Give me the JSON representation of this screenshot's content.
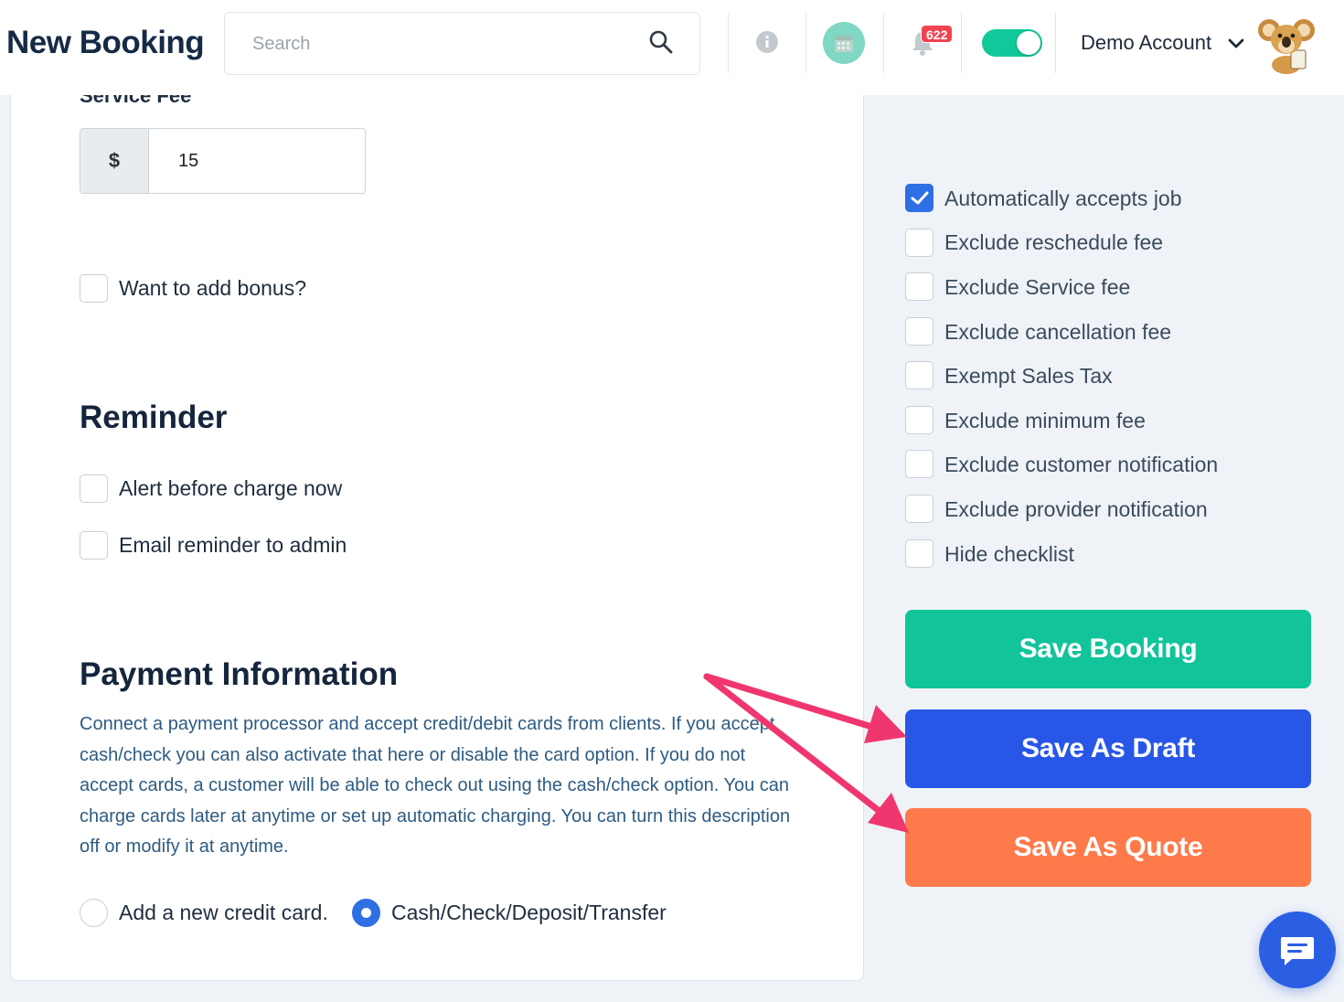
{
  "header": {
    "title": "New Booking",
    "search_placeholder": "Search",
    "notification_count": "622",
    "account_name": "Demo Account",
    "toggle_on": true
  },
  "service_fee": {
    "label": "Service Fee",
    "currency": "$",
    "value": "15"
  },
  "bonus": {
    "label": "Want to add bonus?",
    "checked": false
  },
  "reminder": {
    "title": "Reminder",
    "options": [
      {
        "label": "Alert before charge now",
        "checked": false
      },
      {
        "label": "Email reminder to admin",
        "checked": false
      }
    ]
  },
  "payment": {
    "title": "Payment Information",
    "description": "Connect a payment processor and accept credit/debit cards from clients. If you accept cash/check you can also activate that here or disable the card option. If you do not accept cards, a customer will be able to check out using the cash/check option. You can charge cards later at anytime or set up automatic charging. You can turn this description off or modify it at anytime.",
    "methods": [
      {
        "label": "Add a new credit card.",
        "selected": false
      },
      {
        "label": "Cash/Check/Deposit/Transfer",
        "selected": true
      }
    ]
  },
  "options": [
    {
      "label": "Automatically accepts job",
      "checked": true
    },
    {
      "label": "Exclude reschedule fee",
      "checked": false
    },
    {
      "label": "Exclude Service fee",
      "checked": false
    },
    {
      "label": "Exclude cancellation fee",
      "checked": false
    },
    {
      "label": "Exempt Sales Tax",
      "checked": false
    },
    {
      "label": "Exclude minimum fee",
      "checked": false
    },
    {
      "label": "Exclude customer notification",
      "checked": false
    },
    {
      "label": "Exclude provider notification",
      "checked": false
    },
    {
      "label": "Hide checklist",
      "checked": false
    }
  ],
  "actions": {
    "save_booking": "Save Booking",
    "save_draft": "Save As Draft",
    "save_quote": "Save As Quote"
  },
  "colors": {
    "accent_blue": "#2857e8",
    "accent_green": "#11c49a",
    "accent_orange": "#ff7a4a",
    "arrow_pink": "#f0366e",
    "badge_red": "#ef4350"
  },
  "icons": [
    "search-icon",
    "info-icon",
    "calendar-icon",
    "bell-icon",
    "chevron-down-icon",
    "koala-avatar",
    "chat-icon",
    "checkmark-icon"
  ]
}
